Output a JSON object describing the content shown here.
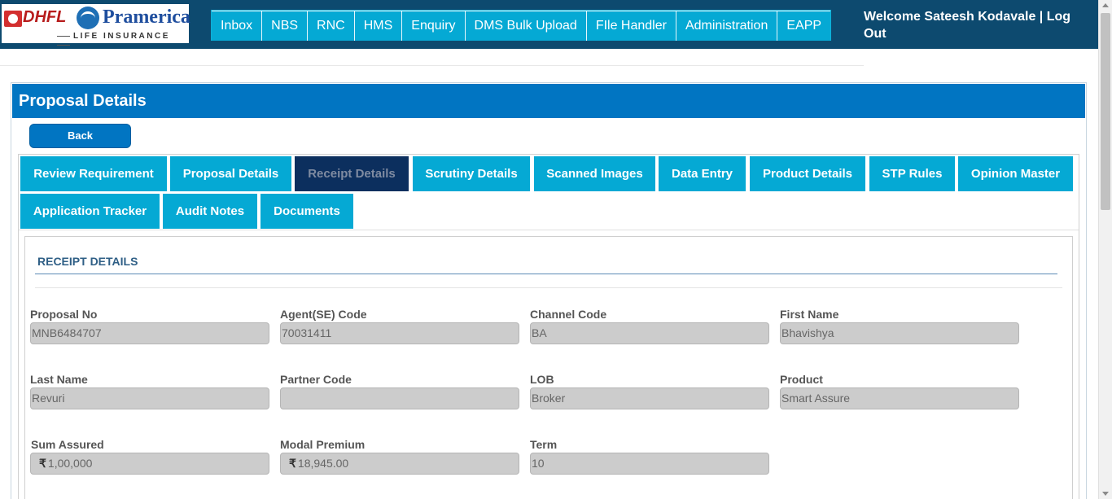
{
  "header": {
    "logo_dhfl": "DHFL",
    "logo_pramerica": "Pramerica",
    "logo_tagline": "LIFE INSURANCE",
    "welcome_text": "Welcome Sateesh Kodavale | Log Out"
  },
  "nav": {
    "items": [
      "Inbox",
      "NBS",
      "RNC",
      "HMS",
      "Enquiry",
      "DMS Bulk Upload",
      "FIle Handler",
      "Administration",
      "EAPP"
    ]
  },
  "panel": {
    "title": "Proposal Details",
    "back_label": "Back"
  },
  "tabs": {
    "items": [
      "Review Requirement",
      "Proposal Details",
      "Receipt Details",
      "Scrutiny Details",
      "Scanned Images",
      "Data Entry",
      "Product Details",
      "STP Rules",
      "Opinion Master",
      "Application Tracker",
      "Audit Notes",
      "Documents"
    ],
    "active": "Receipt Details"
  },
  "receipt": {
    "section_title": "RECEIPT DETAILS",
    "fields": [
      {
        "label": "Proposal No",
        "value": "MNB6484707"
      },
      {
        "label": "Agent(SE) Code",
        "value": "70031411"
      },
      {
        "label": "Channel Code",
        "value": "BA"
      },
      {
        "label": "First Name",
        "value": "Bhavishya"
      },
      {
        "label": "Last Name",
        "value": "Revuri"
      },
      {
        "label": "Partner Code",
        "value": ""
      },
      {
        "label": "LOB",
        "value": "Broker"
      },
      {
        "label": "Product",
        "value": "Smart Assure"
      },
      {
        "label": "Sum Assured",
        "currency": "₹",
        "value": "1,00,000"
      },
      {
        "label": "Modal Premium",
        "currency": "₹",
        "value": "18,945.00"
      },
      {
        "label": "Term",
        "value": "10"
      }
    ]
  },
  "icons": {
    "rupee": "rupee-icon",
    "scroll_up": "chevron-up-icon",
    "scroll_down": "chevron-down-icon"
  },
  "colors": {
    "header_bg": "#0d4a6f",
    "nav_item": "#05a9d4",
    "panel_head": "#0175c2",
    "tab_active": "#0c2f5e",
    "section_title": "#2f5f86"
  }
}
